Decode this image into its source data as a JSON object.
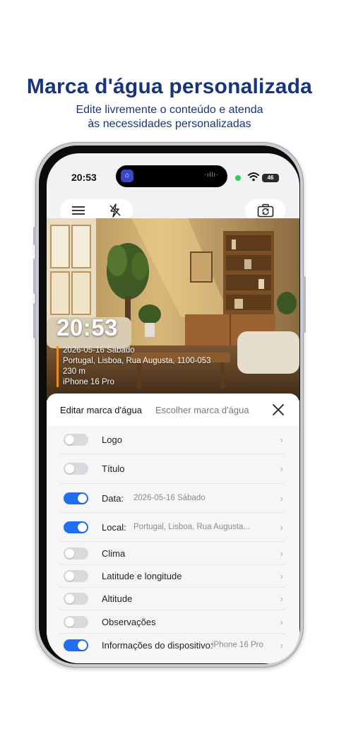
{
  "promo": {
    "title": "Marca d'água personalizada",
    "subtitle_line1": "Edite livremente o conteúdo e atenda",
    "subtitle_line2": "às necessidades personalizadas"
  },
  "status_bar": {
    "time": "20:53",
    "battery": "46"
  },
  "toolbar": {
    "menu_icon": "hamburger-icon",
    "flash_icon": "flash-off-icon",
    "camera_icon": "camera-rotate-icon"
  },
  "watermark": {
    "time": "20:53",
    "date": "2026-05-16 Sábado",
    "location": "Portugal, Lisboa, Rua Augusta, 1100-053",
    "altitude": "230 m",
    "device": "iPhone 16 Pro",
    "accent_color": "#f08a17"
  },
  "sheet": {
    "tab_edit": "Editar marca d'água",
    "tab_choose": "Escolher marca d'água",
    "rows": [
      {
        "label": "Logo",
        "value": "",
        "on": false
      },
      {
        "label": "Título",
        "value": "",
        "on": false
      },
      {
        "label": "Data:",
        "value": "2026-05-16 Sábado",
        "on": true
      },
      {
        "label": "Local:",
        "value": "Portugal, Lisboa, Rua Augusta...",
        "on": true
      },
      {
        "label": "Clima",
        "value": "",
        "on": false
      },
      {
        "label": "Latitude e longitude",
        "value": "",
        "on": false
      },
      {
        "label": "Altitude",
        "value": "",
        "on": false
      },
      {
        "label": "Observações",
        "value": "",
        "on": false
      },
      {
        "label": "Informações do dispositivo:",
        "value": "iPhone 16 Pro",
        "on": true
      }
    ]
  },
  "colors": {
    "brand": "#17347c",
    "toggle_on": "#1f6ef4"
  }
}
